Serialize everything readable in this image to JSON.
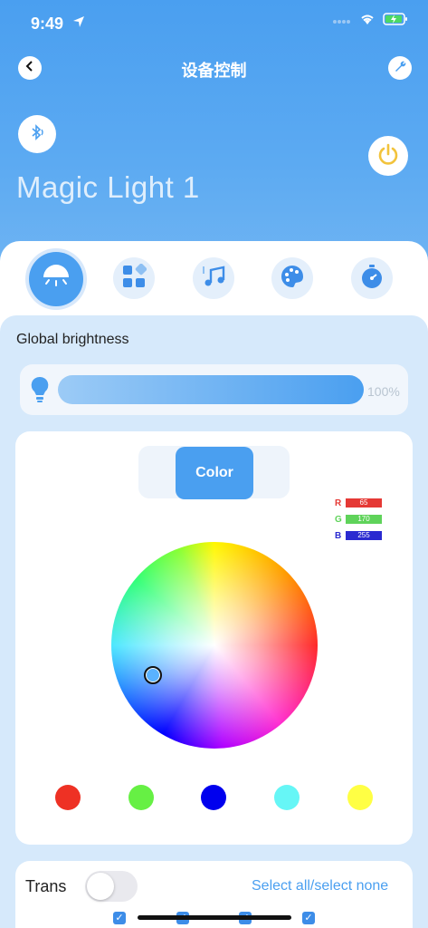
{
  "status_bar": {
    "time": "9:49"
  },
  "nav": {
    "title": "设备控制"
  },
  "device": {
    "name": "Magic Light 1"
  },
  "tabs": [
    {
      "id": "light",
      "icon": "ceiling-light-icon",
      "active": true
    },
    {
      "id": "scenes",
      "icon": "grid-scenes-icon",
      "active": false
    },
    {
      "id": "music",
      "icon": "music-note-icon",
      "active": false
    },
    {
      "id": "palette",
      "icon": "palette-icon",
      "active": false
    },
    {
      "id": "timer",
      "icon": "timer-icon",
      "active": false
    }
  ],
  "brightness": {
    "label": "Global brightness",
    "value_text": "100%",
    "level": 1.0
  },
  "color_mode": {
    "button": "Color"
  },
  "rgb": {
    "r_label": "R",
    "r_value": "65",
    "g_label": "G",
    "g_value": "170",
    "b_label": "B",
    "b_value": "255"
  },
  "swatches": [
    {
      "color": "#ee3124"
    },
    {
      "color": "#66f044"
    },
    {
      "color": "#0000ee"
    },
    {
      "color": "#66f6f6"
    },
    {
      "color": "#ffff44"
    }
  ],
  "trans": {
    "label": "Trans",
    "enabled": false,
    "select_all": "Select all/select none"
  },
  "colors": {
    "accent": "#4a9ff0",
    "power": "#f2c33c"
  }
}
